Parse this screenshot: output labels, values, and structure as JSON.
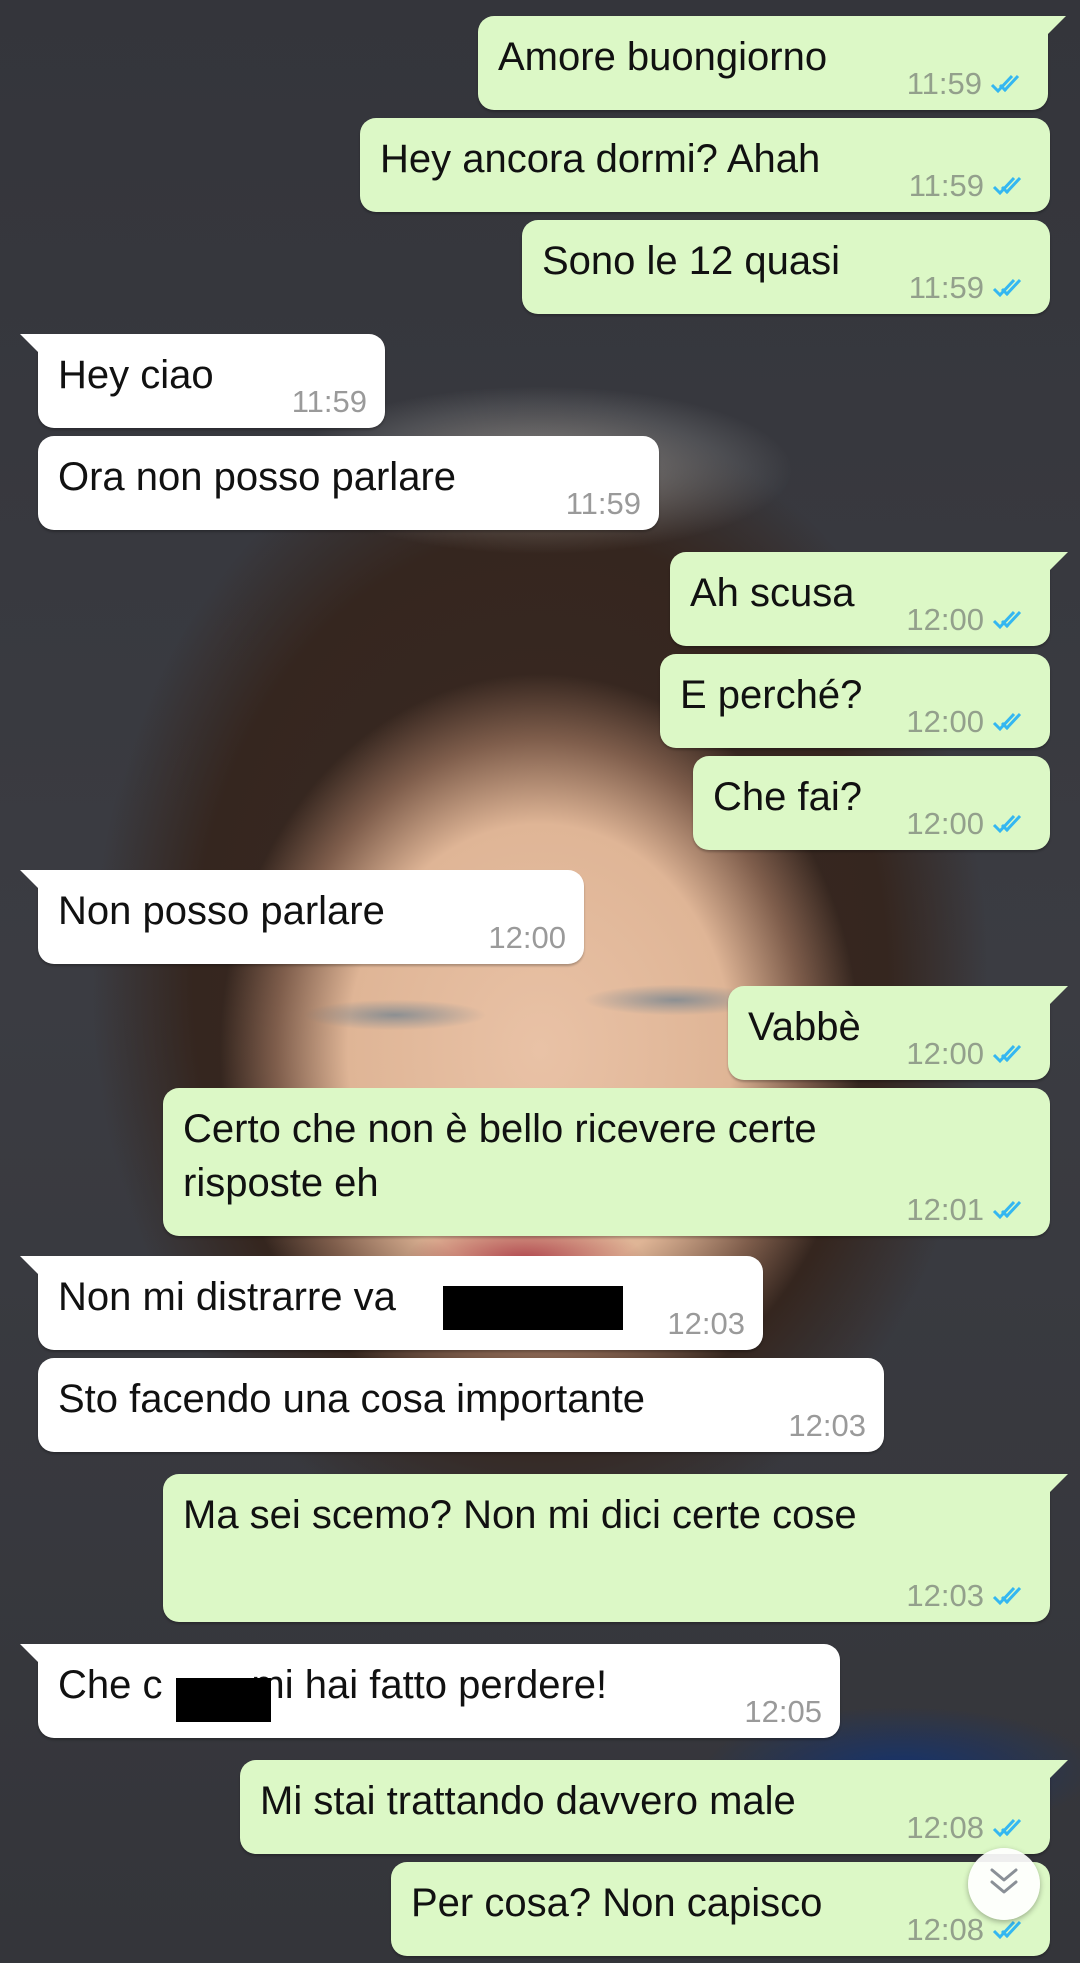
{
  "messages": [
    {
      "dir": "out",
      "text": "Amore buongiorno",
      "time": "11:59",
      "read": true
    },
    {
      "dir": "out",
      "text": "Hey ancora dormi? Ahah",
      "time": "11:59",
      "read": true
    },
    {
      "dir": "out",
      "text": "Sono le 12 quasi",
      "time": "11:59",
      "read": true
    },
    {
      "dir": "in",
      "text": "Hey ciao",
      "time": "11:59"
    },
    {
      "dir": "in",
      "text": "Ora non posso parlare",
      "time": "11:59"
    },
    {
      "dir": "out",
      "text": "Ah scusa",
      "time": "12:00",
      "read": true
    },
    {
      "dir": "out",
      "text": "E perché?",
      "time": "12:00",
      "read": true
    },
    {
      "dir": "out",
      "text": "Che fai?",
      "time": "12:00",
      "read": true
    },
    {
      "dir": "in",
      "text": "Non posso parlare",
      "time": "12:00"
    },
    {
      "dir": "out",
      "text": "Vabbè",
      "time": "12:00",
      "read": true
    },
    {
      "dir": "out",
      "text": "Certo che non è bello ricevere certe\nrisposte eh",
      "time": "12:01",
      "read": true
    },
    {
      "dir": "in",
      "text": "Non mi distrarre va",
      "time": "12:03",
      "redacted": true
    },
    {
      "dir": "in",
      "text": "Sto facendo una cosa importante",
      "time": "12:03"
    },
    {
      "dir": "out",
      "text": "Ma sei scemo? Non mi dici certe cose",
      "time": "12:03",
      "read": true
    },
    {
      "dir": "in",
      "text": "Che c        mi hai fatto perdere!",
      "time": "12:05",
      "redacted": true
    },
    {
      "dir": "out",
      "text": "Mi stai trattando davvero male",
      "time": "12:08",
      "read": true
    },
    {
      "dir": "out",
      "text": "Per cosa? Non capisco",
      "time": "12:08",
      "read": true
    }
  ],
  "colors": {
    "outgoing_bubble": "#dcf8c6",
    "incoming_bubble": "#ffffff",
    "read_ticks": "#34b7f1"
  },
  "icons": {
    "read_receipt": "double-check-icon",
    "scroll_down": "chevron-double-down-icon"
  }
}
